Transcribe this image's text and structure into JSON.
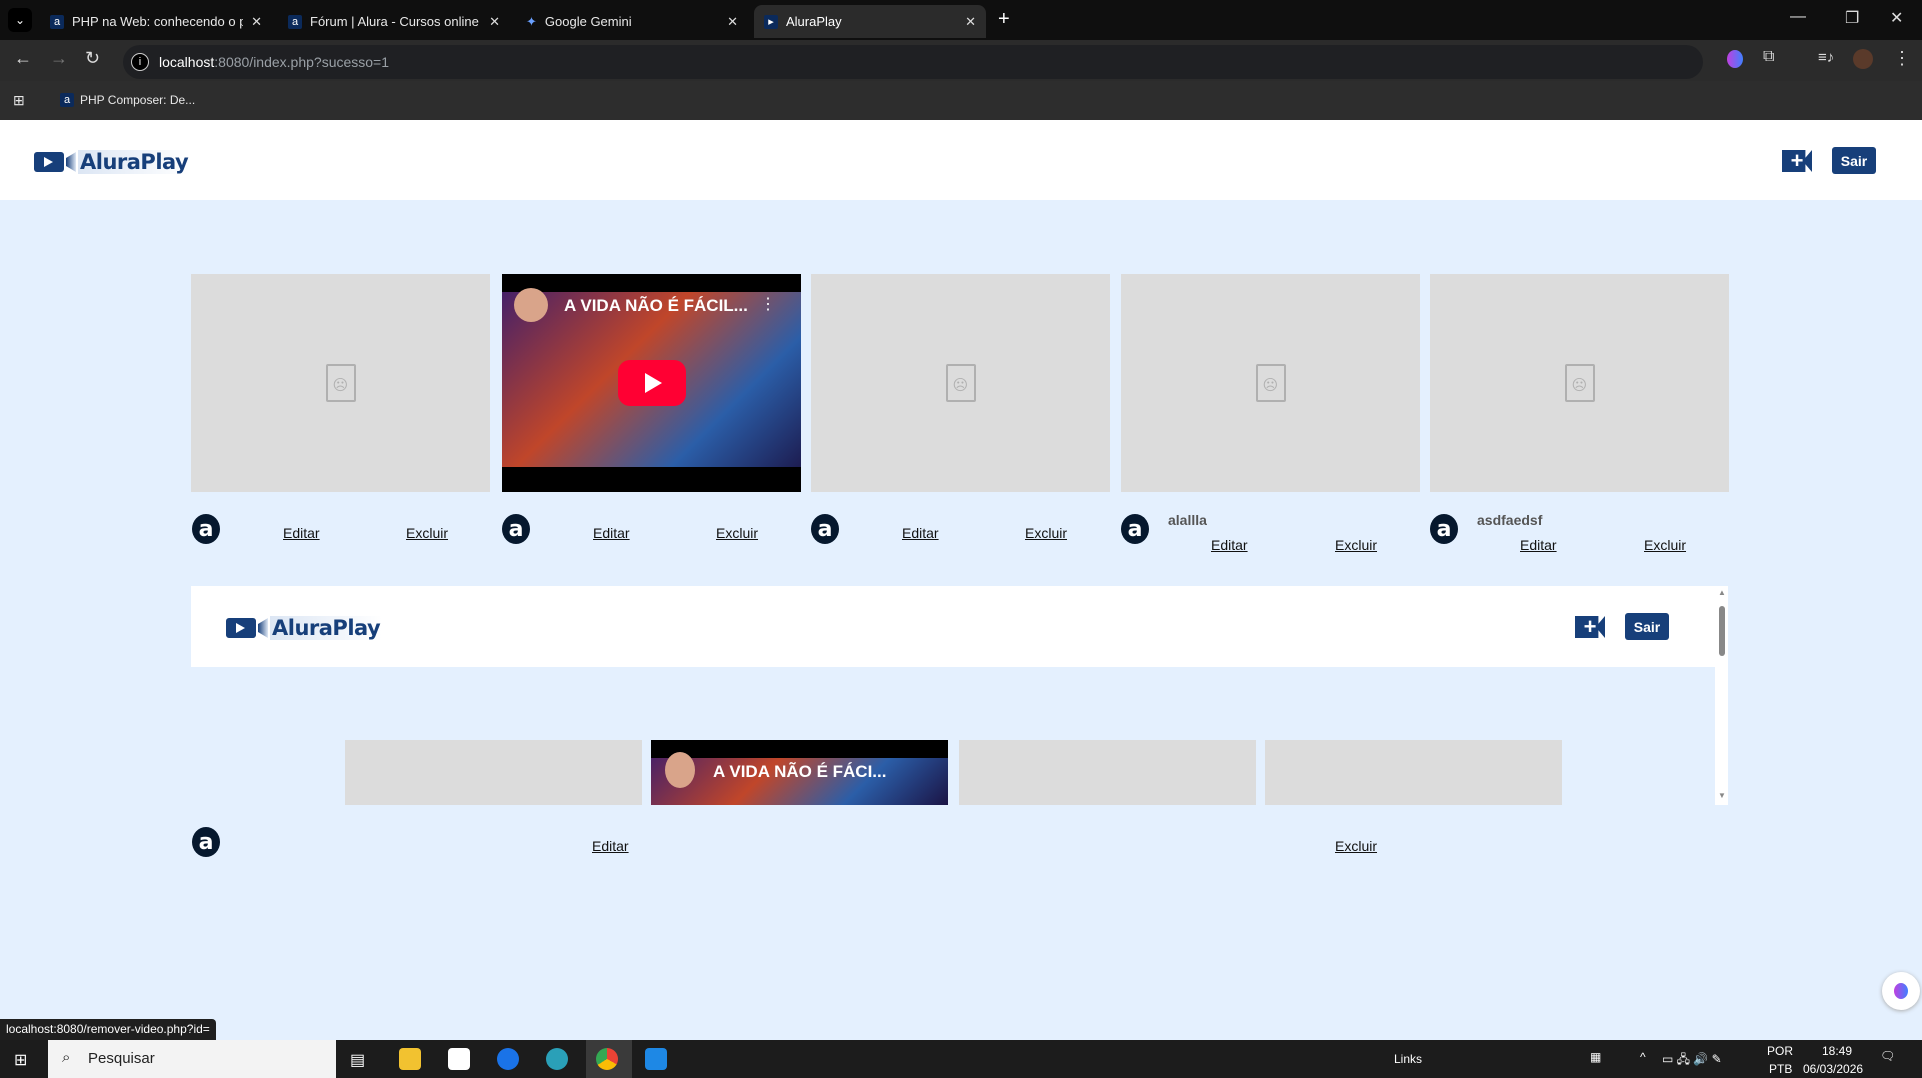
{
  "browser": {
    "tabs": [
      {
        "title": "PHP na Web: conhecendo o pa",
        "active": false
      },
      {
        "title": "Fórum | Alura - Cursos online d",
        "active": false
      },
      {
        "title": "Google Gemini",
        "active": false
      },
      {
        "title": "AluraPlay",
        "active": true
      }
    ],
    "url_host": "localhost",
    "url_rest": ":8080/index.php?sucesso=1",
    "bookmark": "PHP Composer: De..."
  },
  "header": {
    "logo_text": "AluraPlay",
    "logout_label": "Sair",
    "brand_color": "#173f7a"
  },
  "videos": [
    {
      "title": "",
      "thumbnail": "broken",
      "edit": "Editar",
      "delete": "Excluir"
    },
    {
      "title": "",
      "thumbnail": "youtube",
      "embed_title": "A VIDA NÃO É FÁCIL...",
      "edit": "Editar",
      "delete": "Excluir"
    },
    {
      "title": "",
      "thumbnail": "broken",
      "edit": "Editar",
      "delete": "Excluir"
    },
    {
      "title": "alallla",
      "thumbnail": "broken",
      "edit": "Editar",
      "delete": "Excluir"
    },
    {
      "title": "asdfaedsf",
      "thumbnail": "broken",
      "edit": "Editar",
      "delete": "Excluir"
    }
  ],
  "embedded": {
    "logo_text": "AluraPlay",
    "logout_label": "Sair",
    "embed_title": "A VIDA NÃO É FÁCI...",
    "edit": "Editar",
    "delete": "Excluir"
  },
  "status_url": "localhost:8080/remover-video.php?id=",
  "taskbar": {
    "search": "Pesquisar",
    "links": "Links",
    "lang1": "POR",
    "lang2": "PTB",
    "time": "18:49",
    "date": "06/03/2026"
  }
}
